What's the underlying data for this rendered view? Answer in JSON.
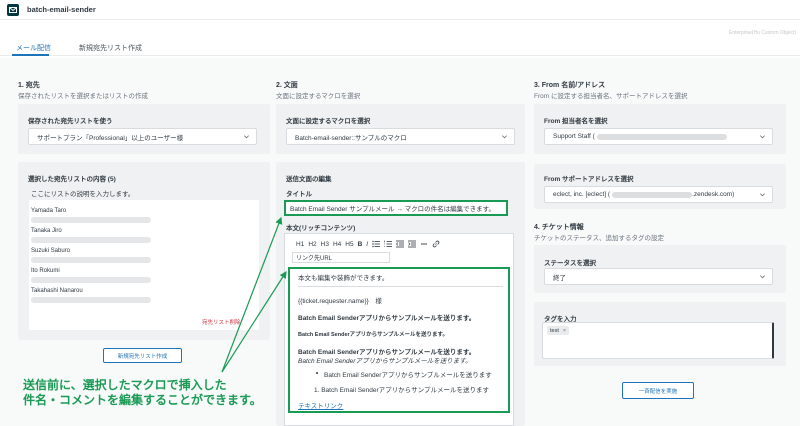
{
  "app": {
    "title": "batch-email-sender",
    "env_label": "Enterprise(Hu Custom Object)"
  },
  "tabs": [
    {
      "label": "メール配信",
      "active": true
    },
    {
      "label": "新規宛先リスト作成",
      "active": false
    }
  ],
  "section1": {
    "heading": "1. 宛先",
    "subtitle": "保存されたリストを選択またはリストの作成",
    "saved_list_label": "保存された宛先リストを使う",
    "saved_list_value": "サポートプラン「Professional」以上のユーザー様",
    "selected_list_label": "選択した宛先リストの内容 (5)",
    "description": "ここにリストの説明を入力します。",
    "recipients": [
      "Yamada Taro",
      "Tanaka Jiro",
      "Suzuki Saburo",
      "Ito Rokumi",
      "Takahashi Nanarou"
    ],
    "delete_label": "宛先リスト削除",
    "create_button": "新規宛先リスト作成"
  },
  "section2": {
    "heading": "2. 文面",
    "subtitle": "文面に設定するマクロを選択",
    "macro_label": "文面に設定するマクロを選択",
    "macro_value": "Batch-email-sender::サンプルのマクロ",
    "edit_label": "送信文面の編集",
    "title_label": "タイトル",
    "title_value": "Batch Email Sender サンプルメール → マクロの件名は編集できます。",
    "body_label": "本文(リッチコンテンツ)",
    "toolbar": [
      "H1",
      "H2",
      "H3",
      "H4",
      "H5",
      "B",
      "I"
    ],
    "link_placeholder": "リンク先URL",
    "content": {
      "line1": "本文も編集や装飾ができます。",
      "placeholder": "{{ticket.requester.name}}　様",
      "line_bold": "Batch Email Senderアプリからサンプルメールを送ります。",
      "line_small": "Batch Email Senderアプリからサンプルメールを送ります。",
      "line_bold2": "Batch Email Senderアプリからサンプルメールを送ります。",
      "line_italic": "Batch Email Senderアプリからサンプルメールを送ります。",
      "bullet_item": "Batch Email Senderアプリからサンプルメールを送ります",
      "numbered_item": "1. Batch Email Senderアプリからサンプルメールを送ります",
      "link_text": "テキストリンク"
    }
  },
  "section3": {
    "heading": "3. From 名前/アドレス",
    "subtitle": "From に設定する担当者名、サポートアドレスを選択",
    "agent_label": "From 担当者名を選択",
    "agent_value": "Support Staff (",
    "address_label": "From サポートアドレスを選択",
    "address_prefix": "eclect, inc. [eclect] (",
    "address_suffix": ".zendesk.com)"
  },
  "section4": {
    "heading": "4. チケット情報",
    "subtitle": "チケットのステータス、追加するタグの設定",
    "status_label": "ステータスを選択",
    "status_value": "終了",
    "tag_label": "タグを入力",
    "tags": [
      "test"
    ],
    "submit_button": "一斉配信を実施"
  },
  "annotation": {
    "line1": "送信前に、選択したマクロで挿入した",
    "line2": "件名・コメントを編集することができます。",
    "color": "#1a9b55"
  },
  "colors": {
    "accent": "#1f73b7",
    "highlight": "#1a9b55",
    "danger": "#cc3340"
  }
}
